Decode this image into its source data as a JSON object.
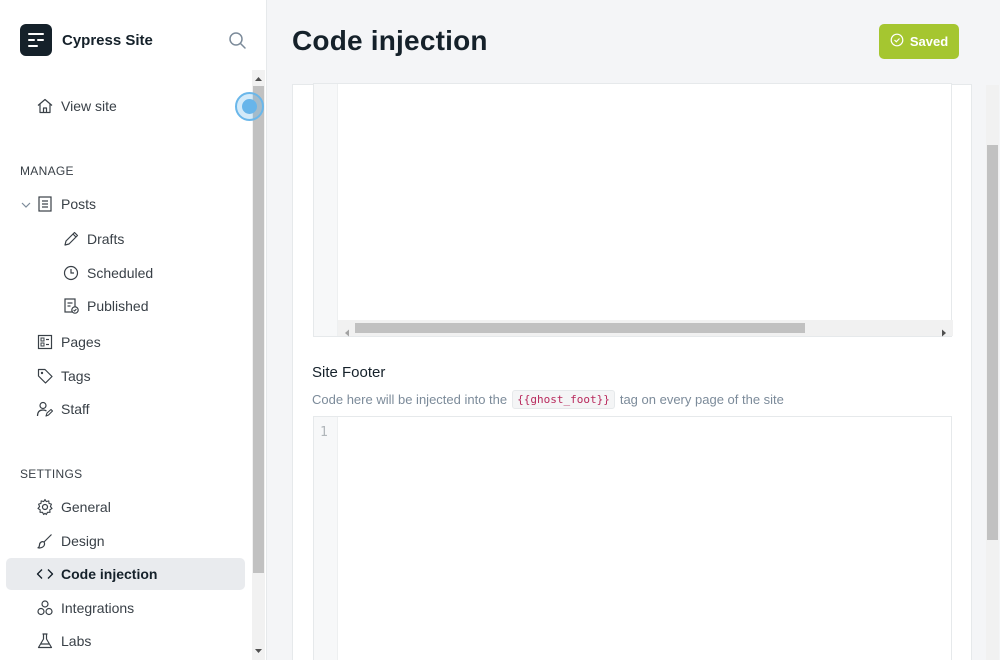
{
  "brand": {
    "name": "Cypress Site"
  },
  "sidebar": {
    "view_site": "View site",
    "manage_label": "MANAGE",
    "settings_label": "SETTINGS",
    "manage_items": [
      {
        "label": "Posts",
        "icon": "posts-icon"
      },
      {
        "label": "Drafts",
        "icon": "pencil-icon"
      },
      {
        "label": "Scheduled",
        "icon": "clock-icon"
      },
      {
        "label": "Published",
        "icon": "published-icon"
      },
      {
        "label": "Pages",
        "icon": "pages-icon"
      },
      {
        "label": "Tags",
        "icon": "tag-icon"
      },
      {
        "label": "Staff",
        "icon": "staff-icon"
      }
    ],
    "settings_items": [
      {
        "label": "General",
        "icon": "gear-icon"
      },
      {
        "label": "Design",
        "icon": "brush-icon"
      },
      {
        "label": "Code injection",
        "icon": "code-icon",
        "active": true
      },
      {
        "label": "Integrations",
        "icon": "integrations-icon"
      },
      {
        "label": "Labs",
        "icon": "flask-icon"
      }
    ]
  },
  "header": {
    "title": "Code injection",
    "saved_label": "Saved"
  },
  "footer_section": {
    "title": "Site Footer",
    "desc_before": "Code here will be injected into the",
    "code_tag": "{{ghost_foot}}",
    "desc_after": "tag on every page of the site",
    "line_number": "1"
  },
  "colors": {
    "accent": "#a5c630",
    "active_bg": "#e9ebee",
    "code": "#b8295c"
  }
}
